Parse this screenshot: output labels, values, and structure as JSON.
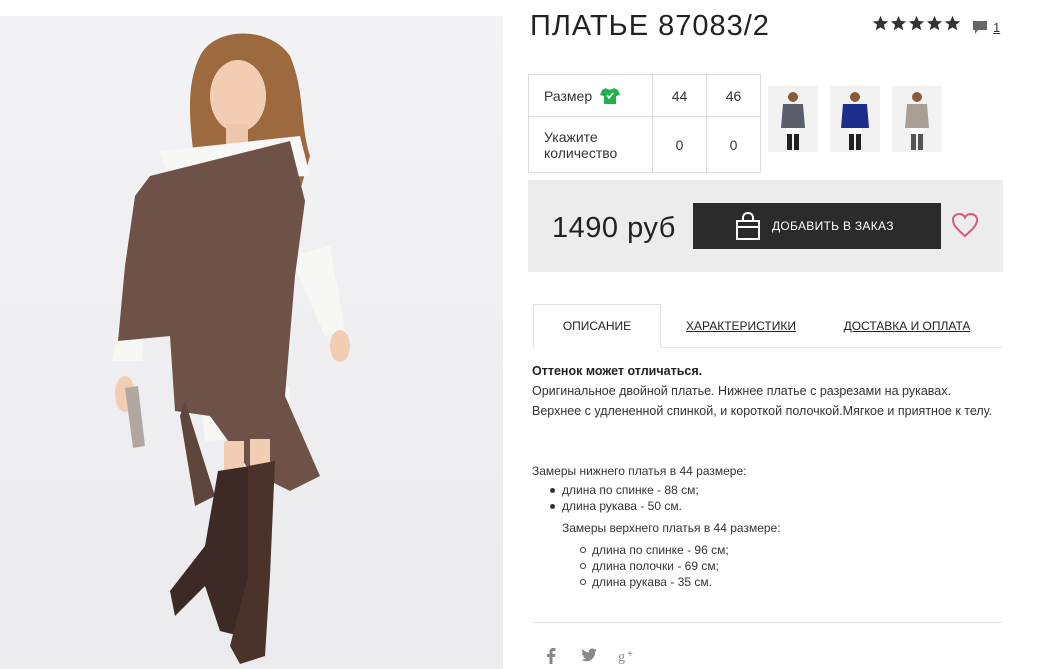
{
  "product": {
    "title": "ПЛАТЬЕ 87083/2",
    "rating_stars": 5,
    "comment_count": "1"
  },
  "size_table": {
    "size_label": "Размер",
    "sizes": [
      "44",
      "46"
    ],
    "qty_label": "Укажите количество",
    "quantities": [
      "0",
      "0"
    ]
  },
  "thumbnails": [
    {
      "name": "thumb-grey-dress",
      "color": "#5a5e6a"
    },
    {
      "name": "thumb-blue-dress",
      "color": "#1d2f8a"
    },
    {
      "name": "thumb-beige-dress",
      "color": "#a89e94"
    }
  ],
  "buy": {
    "price": "1490 руб",
    "add_button": "ДОБАВИТЬ В ЗАКАЗ"
  },
  "tabs": [
    "ОПИСАНИЕ",
    "ХАРАКТЕРИСТИКИ",
    "ДОСТАВКА И ОПЛАТА"
  ],
  "description": {
    "note": "Оттенок может отличаться.",
    "text": "Оригинальное двойной платье. Нижнее платье с разрезами на рукавах. Верхнее с удлененной спинкой, и короткой полочкой.Мягкое и приятное к телу."
  },
  "measurements": {
    "lower_title": "Замеры нижнего платья в 44 размере:",
    "lower_items": [
      "длина по спинке - 88 см;",
      "длина рукава - 50 см."
    ],
    "upper_title": "Замеры верхнего платья в 44 размере:",
    "upper_items": [
      "длина по спинке - 96 см;",
      "длина полочки - 69 см;",
      "длина рукава - 35 см."
    ]
  },
  "social": [
    "facebook-icon",
    "twitter-icon",
    "google-plus-icon"
  ],
  "colors": {
    "dark_button": "#2b2b2b",
    "panel_bg": "#ececec",
    "size_icon_green": "#21b24b",
    "heart": "#d85a7a",
    "dress_brown": "#6e5248"
  }
}
